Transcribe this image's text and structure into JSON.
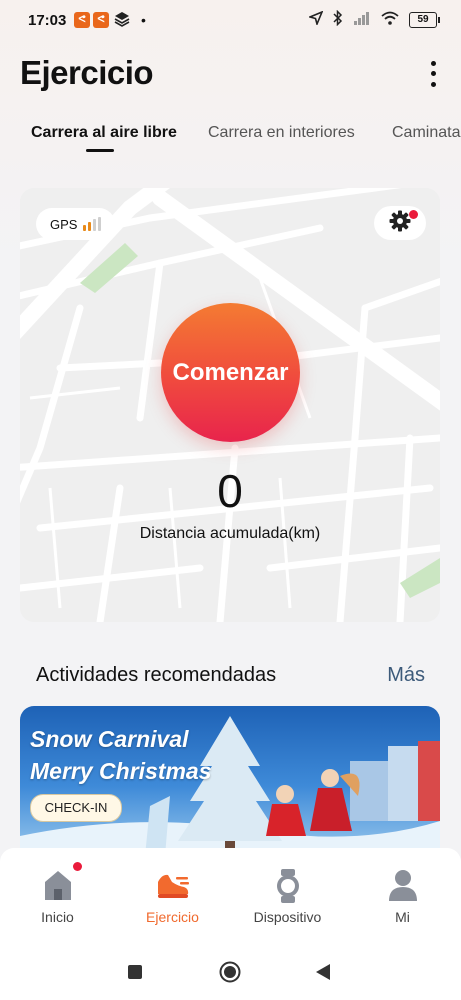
{
  "status_bar": {
    "time": "17:03",
    "app_badge_1": "ᕙ",
    "app_badge_2": "ᕙ",
    "dot": "•",
    "battery": "59"
  },
  "header": {
    "title": "Ejercicio"
  },
  "tabs": [
    {
      "label": "Carrera al aire libre",
      "active": true
    },
    {
      "label": "Carrera en interiores",
      "active": false
    },
    {
      "label": "Caminata",
      "active": false
    }
  ],
  "map_card": {
    "gps_label": "GPS",
    "gps_signal_bars": 2,
    "start_label": "Comenzar",
    "distance_value": "0",
    "distance_label": "Distancia acumulada(km)"
  },
  "recommended": {
    "title": "Actividades recomendadas",
    "more_label": "Más",
    "banner": {
      "line1": "Snow Carnival",
      "line2": "Merry Christmas",
      "button": "CHECK-IN"
    }
  },
  "bottom_nav": [
    {
      "label": "Inicio",
      "icon": "home-icon",
      "badge": true
    },
    {
      "label": "Ejercicio",
      "icon": "running-shoe-icon",
      "active": true
    },
    {
      "label": "Dispositivo",
      "icon": "watch-icon"
    },
    {
      "label": "Mi",
      "icon": "person-icon"
    }
  ],
  "colors": {
    "accent": "#f06a2e",
    "start_top": "#f47b32",
    "start_bottom": "#e8244c",
    "badge": "#ea1b3b",
    "link": "#3c5a7a"
  }
}
